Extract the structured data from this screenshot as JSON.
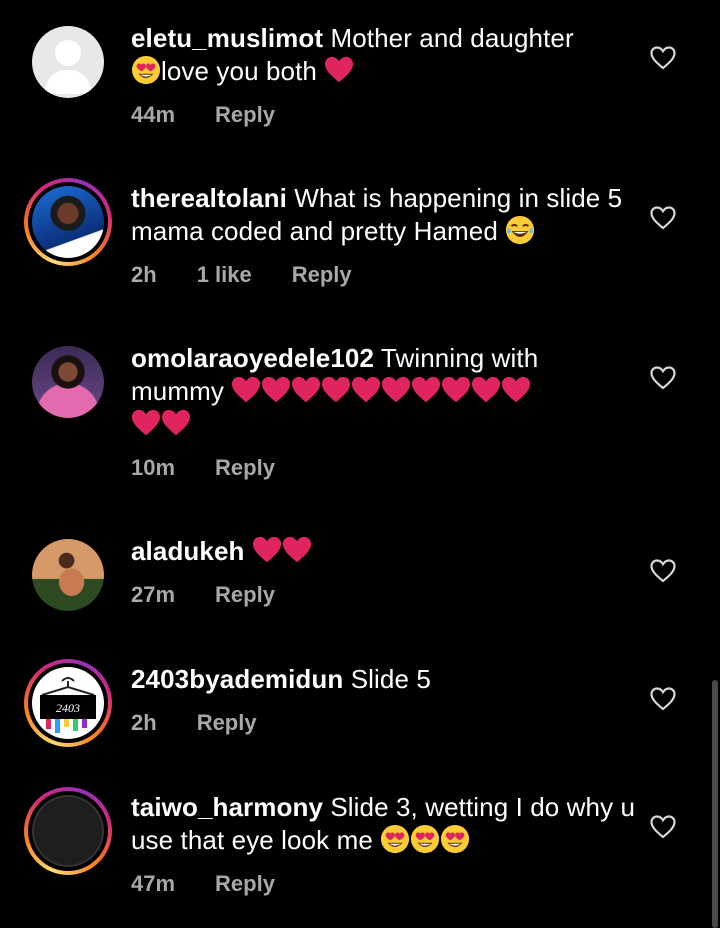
{
  "comments": [
    {
      "username": "eletu_muslimot",
      "text": "Mother and daughter",
      "text2": "love you both",
      "time": "44m",
      "reply": "Reply",
      "avatar": "default-avatar"
    },
    {
      "username": "therealtolani",
      "text": "What is happening in slide 5 mama coded and pretty Hamed",
      "time": "2h",
      "likes": "1 like",
      "reply": "Reply",
      "avatar": "woman-photo-blue"
    },
    {
      "username": "omolaraoyedele102",
      "text": "Twinning with mummy",
      "time": "10m",
      "reply": "Reply",
      "avatar": "woman-photo-pink"
    },
    {
      "username": "aladukeh",
      "text": "",
      "time": "27m",
      "reply": "Reply",
      "avatar": "woman-photo-outdoor"
    },
    {
      "username": "2403byademidun",
      "text": "Slide 5",
      "time": "2h",
      "reply": "Reply",
      "avatar": "logo-2403"
    },
    {
      "username": "taiwo_harmony",
      "text": "Slide 3, wetting I do why u use that eye look me",
      "time": "47m",
      "reply": "Reply",
      "avatar": "dark-avatar"
    }
  ],
  "logo_text": "2403",
  "icons": {
    "like": "heart-outline-icon",
    "emoji_heart": "red-heart",
    "emoji_love": "heart-eyes",
    "emoji_laugh": "tears-of-joy"
  },
  "colors": {
    "background": "#000000",
    "meta": "#a8a8a8",
    "heart_red": "#e0245e"
  }
}
